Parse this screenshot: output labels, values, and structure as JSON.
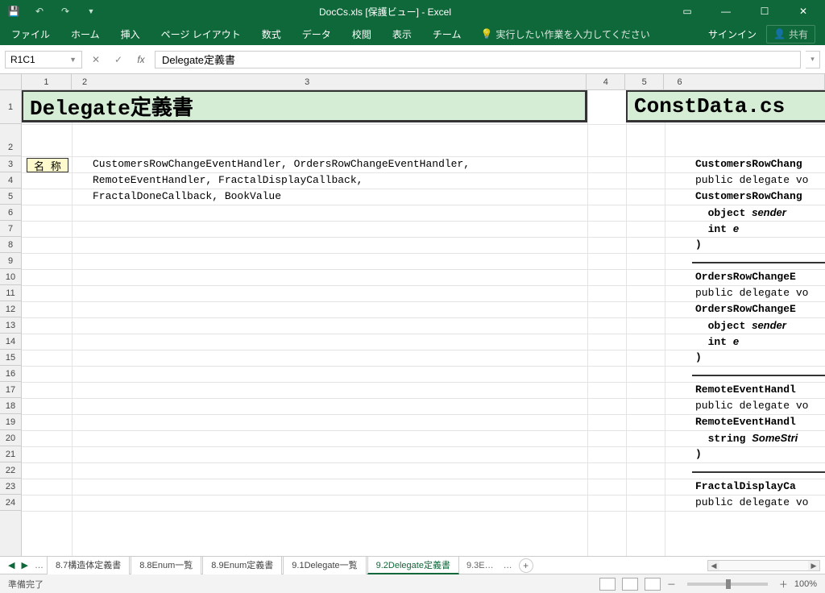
{
  "titlebar": {
    "title": "DocCs.xls [保護ビュー] - Excel"
  },
  "ribbon": {
    "tabs": [
      "ファイル",
      "ホーム",
      "挿入",
      "ページ レイアウト",
      "数式",
      "データ",
      "校閲",
      "表示",
      "チーム"
    ],
    "tell_me": "実行したい作業を入力してください",
    "signin": "サインイン",
    "share": "共有"
  },
  "formula": {
    "name_box": "R1C1",
    "value": "Delegate定義書"
  },
  "columns": [
    1,
    2,
    3,
    4,
    5,
    6
  ],
  "rows": [
    1,
    2,
    3,
    4,
    5,
    6,
    7,
    8,
    9,
    10,
    11,
    12,
    13,
    14,
    15,
    16,
    17,
    18,
    19,
    20,
    21,
    22,
    23,
    24
  ],
  "sheet": {
    "title_left": "Delegate定義書",
    "title_right": "ConstData.cs",
    "label_name": "名 称",
    "names_lines": [
      "CustomersRowChangeEventHandler, OrdersRowChangeEventHandler,",
      "RemoteEventHandler, FractalDisplayCallback,",
      "FractalDoneCallback, BookValue"
    ],
    "code_lines": [
      {
        "t": "CustomersRowChang",
        "b": true
      },
      {
        "t": "public delegate vo",
        "b": false
      },
      {
        "t": "CustomersRowChang",
        "b": true
      },
      {
        "t": "  object ",
        "i": "sender",
        "b": true
      },
      {
        "t": "  int ",
        "i": "e",
        "b": true
      },
      {
        "t": ")",
        "b": true
      },
      {
        "t": "",
        "b": false
      },
      {
        "t": "OrdersRowChangeE",
        "b": true
      },
      {
        "t": "public delegate vo",
        "b": false
      },
      {
        "t": "OrdersRowChangeE",
        "b": true
      },
      {
        "t": "  object ",
        "i": "sender",
        "b": true
      },
      {
        "t": "  int ",
        "i": "e",
        "b": true
      },
      {
        "t": ")",
        "b": true
      },
      {
        "t": "",
        "b": false
      },
      {
        "t": "RemoteEventHandl",
        "b": true
      },
      {
        "t": "public delegate vo",
        "b": false
      },
      {
        "t": "RemoteEventHandl",
        "b": true
      },
      {
        "t": "  string ",
        "i": "SomeStri",
        "b": true
      },
      {
        "t": ")",
        "b": true
      },
      {
        "t": "",
        "b": false
      },
      {
        "t": "FractalDisplayCa",
        "b": true
      },
      {
        "t": "public delegate vo",
        "b": false
      }
    ]
  },
  "tabs": {
    "items": [
      "8.7構造体定義書",
      "8.8Enum一覧",
      "8.9Enum定義書",
      "9.1Delegate一覧",
      "9.2Delegate定義書"
    ],
    "active_index": 4,
    "more": "9.3E…"
  },
  "status": {
    "ready": "準備完了",
    "zoom": "100%",
    "zoom_minus": "－",
    "zoom_plus": "＋"
  }
}
